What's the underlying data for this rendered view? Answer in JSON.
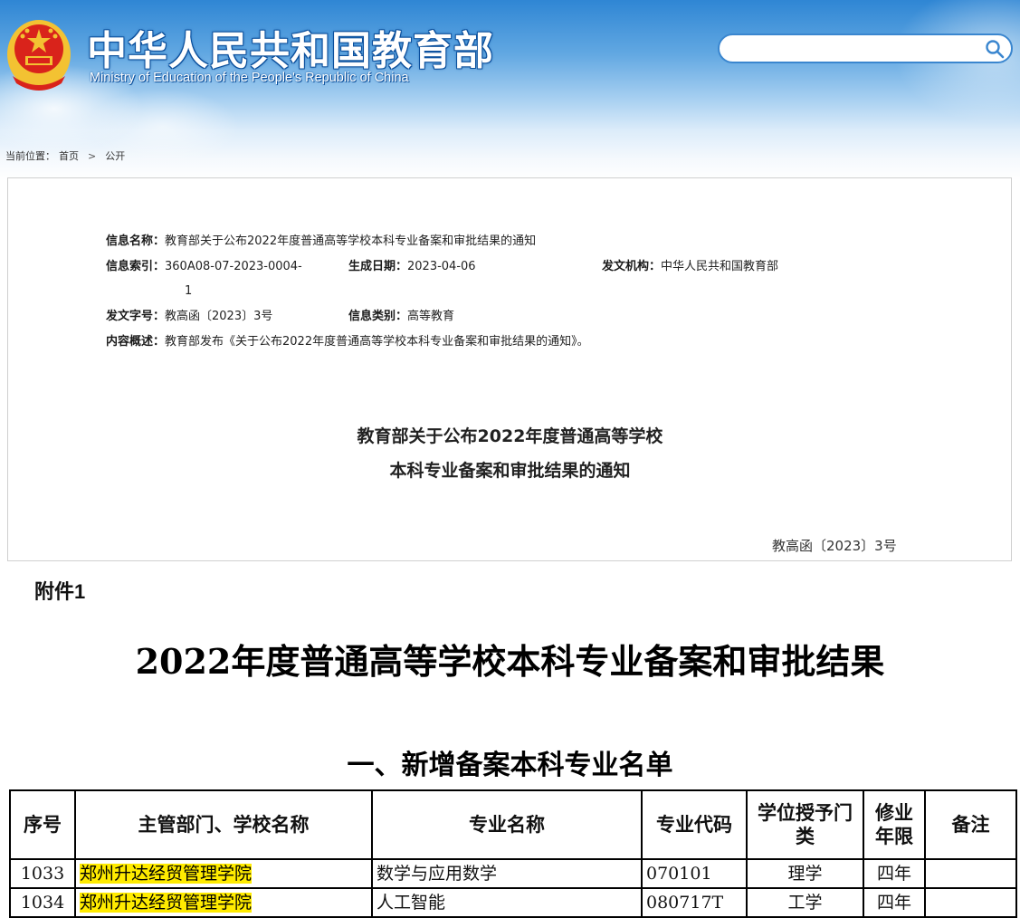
{
  "header": {
    "site_title": "中华人民共和国教育部",
    "site_subtitle": "Ministry of Education of the People's Republic of China",
    "search": {
      "placeholder": ""
    }
  },
  "breadcrumb": {
    "prefix": "当前位置：",
    "items": [
      "首页",
      "公开"
    ],
    "separator": ">"
  },
  "info": {
    "name_label": "信息名称：",
    "name_value": "教育部关于公布2022年度普通高等学校本科专业备案和审批结果的通知",
    "index_label": "信息索引：",
    "index_value_line1": "360A08-07-2023-0004-",
    "index_value_line2": "1",
    "date_label": "生成日期：",
    "date_value": "2023-04-06",
    "issuer_label": "发文机构：",
    "issuer_value": "中华人民共和国教育部",
    "docno_label": "发文字号：",
    "docno_value": "教高函〔2023〕3号",
    "category_label": "信息类别：",
    "category_value": "高等教育",
    "summary_label": "内容概述：",
    "summary_value": "教育部发布《关于公布2022年度普通高等学校本科专业备案和审批结果的通知》。"
  },
  "document": {
    "title_line1": "教育部关于公布2022年度普通高等学校",
    "title_line2": "本科专业备案和审批结果的通知",
    "doc_number": "教高函〔2023〕3号"
  },
  "attachment": {
    "label": "附件1",
    "title": "2022年度普通高等学校本科专业备案和审批结果",
    "section_title": "一、新增备案本科专业名单"
  },
  "table": {
    "headers": [
      "序号",
      "主管部门、学校名称",
      "专业名称",
      "专业代码",
      "学位授予门类",
      "修业年限",
      "备注"
    ],
    "rows": [
      [
        "1033",
        "郑州升达经贸管理学院",
        "数学与应用数学",
        "070101",
        "理学",
        "四年",
        ""
      ],
      [
        "1034",
        "郑州升达经贸管理学院",
        "人工智能",
        "080717T",
        "工学",
        "四年",
        ""
      ]
    ],
    "highlight_color": "#ffeb00"
  },
  "colors": {
    "banner_top": "#2f86d4",
    "title_outline": "#0b4f9c",
    "emblem_red": "#d9231b",
    "emblem_gold": "#f3c232"
  }
}
